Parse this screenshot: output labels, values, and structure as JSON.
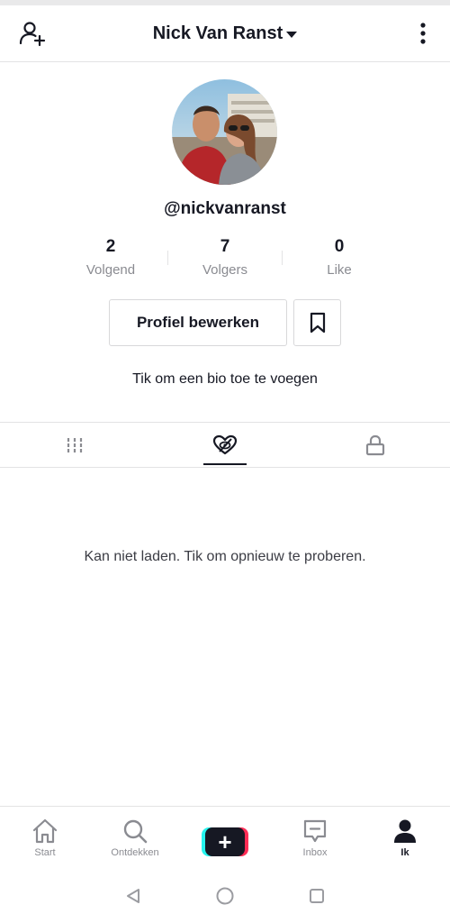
{
  "header": {
    "title": "Nick Van Ranst",
    "add_friend_icon": "add-person-icon",
    "menu_icon": "more-vertical-icon"
  },
  "profile": {
    "username": "@nickvanranst",
    "stats": [
      {
        "value": "2",
        "label": "Volgend"
      },
      {
        "value": "7",
        "label": "Volgers"
      },
      {
        "value": "0",
        "label": "Like"
      }
    ],
    "edit_label": "Profiel bewerken",
    "bio_prompt": "Tik om een bio toe te voegen"
  },
  "tabs": [
    {
      "name": "videos",
      "icon": "grid-icon",
      "active": false
    },
    {
      "name": "liked",
      "icon": "heart-hidden-icon",
      "active": true
    },
    {
      "name": "private",
      "icon": "lock-icon",
      "active": false
    }
  ],
  "content": {
    "empty_message": "Kan niet laden. Tik om opnieuw te proberen."
  },
  "bottom_nav": {
    "items": [
      {
        "label": "Start",
        "icon": "home-icon"
      },
      {
        "label": "Ontdekken",
        "icon": "search-icon"
      },
      {
        "label": "",
        "icon": "plus-icon"
      },
      {
        "label": "Inbox",
        "icon": "inbox-icon"
      },
      {
        "label": "Ik",
        "icon": "person-icon"
      }
    ]
  },
  "colors": {
    "text_primary": "#161823",
    "text_secondary": "#8a8b91",
    "divider": "#e3e3e4",
    "accent_cyan": "#25f4ee",
    "accent_red": "#fe2c55"
  }
}
